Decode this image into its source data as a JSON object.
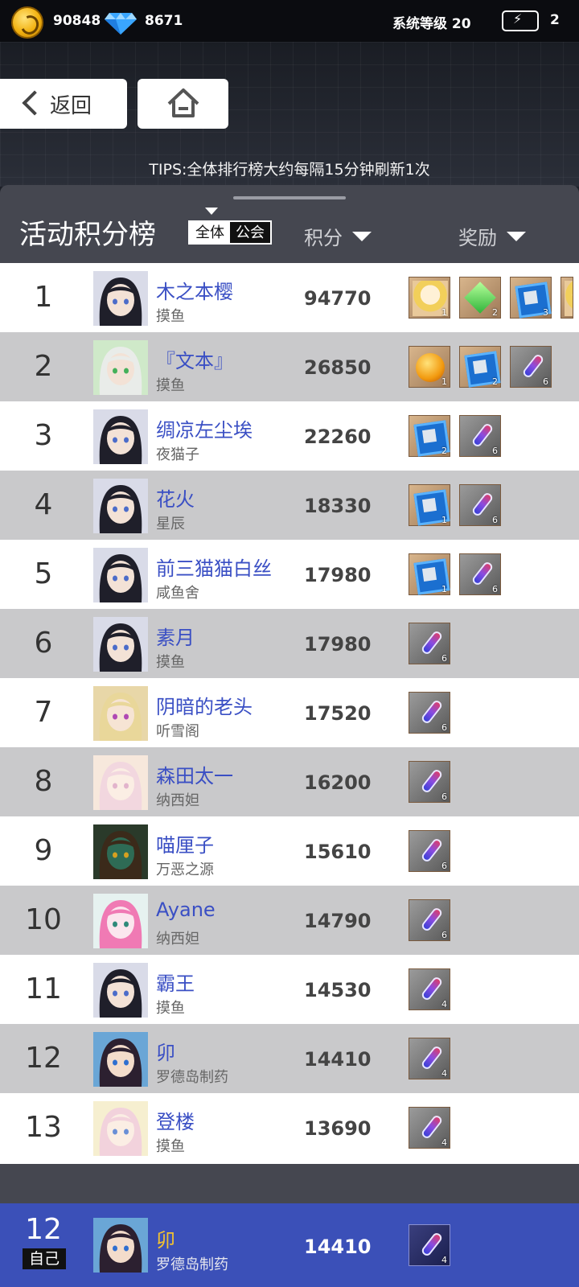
{
  "topbar": {
    "coins": "90848",
    "gems": "8671",
    "system_level": "系统等级 20",
    "energy": "2"
  },
  "nav": {
    "back_label": "返回"
  },
  "tips": "TIPS:全体排行榜大约每隔15分钟刷新1次",
  "board": {
    "title": "活动积分榜",
    "scope_all": "全体",
    "scope_guild": "公会",
    "col_score": "积分",
    "col_reward": "奖励"
  },
  "rows": [
    {
      "rank": "1",
      "name": "木之本樱",
      "guild": "摸鱼",
      "score": "94770",
      "avatar": "dark-hair-girl",
      "rewards": [
        {
          "type": "portrait",
          "count": "1"
        },
        {
          "type": "gem",
          "count": "2"
        },
        {
          "type": "box",
          "count": "3"
        },
        {
          "type": "portrait-clipped",
          "count": ""
        }
      ]
    },
    {
      "rank": "2",
      "name": "『文本』",
      "guild": "摸鱼",
      "score": "26850",
      "avatar": "white-hair-green",
      "rewards": [
        {
          "type": "orb",
          "count": "1"
        },
        {
          "type": "box",
          "count": "2"
        },
        {
          "type": "vial",
          "count": "6"
        }
      ]
    },
    {
      "rank": "3",
      "name": "绸凉左尘埃",
      "guild": "夜猫子",
      "score": "22260",
      "avatar": "dark-hair-girl",
      "rewards": [
        {
          "type": "box",
          "count": "2"
        },
        {
          "type": "vial",
          "count": "6"
        }
      ]
    },
    {
      "rank": "4",
      "name": "花火",
      "guild": "星辰",
      "score": "18330",
      "avatar": "dark-hair-girl",
      "rewards": [
        {
          "type": "box",
          "count": "1"
        },
        {
          "type": "vial",
          "count": "6"
        }
      ]
    },
    {
      "rank": "5",
      "name": "前三猫猫白丝",
      "guild": "咸鱼舍",
      "score": "17980",
      "avatar": "dark-hair-girl",
      "rewards": [
        {
          "type": "box",
          "count": "1"
        },
        {
          "type": "vial",
          "count": "6"
        }
      ]
    },
    {
      "rank": "6",
      "name": "素月",
      "guild": "摸鱼",
      "score": "17980",
      "avatar": "dark-hair-girl",
      "rewards": [
        {
          "type": "vial",
          "count": "6"
        }
      ]
    },
    {
      "rank": "7",
      "name": "阴暗的老头",
      "guild": "听雪阁",
      "score": "17520",
      "avatar": "blonde-bunny",
      "rewards": [
        {
          "type": "vial",
          "count": "6"
        }
      ]
    },
    {
      "rank": "8",
      "name": "森田太一",
      "guild": "纳西妲",
      "score": "16200",
      "avatar": "pink-hair-girl",
      "rewards": [
        {
          "type": "vial",
          "count": "6"
        }
      ]
    },
    {
      "rank": "9",
      "name": "喵厘子",
      "guild": "万恶之源",
      "score": "15610",
      "avatar": "masked-green",
      "rewards": [
        {
          "type": "vial",
          "count": "6"
        }
      ]
    },
    {
      "rank": "10",
      "name": "Ayane",
      "guild": "纳西妲",
      "score": "14790",
      "avatar": "pink-cat-girl",
      "rewards": [
        {
          "type": "vial",
          "count": "6"
        }
      ]
    },
    {
      "rank": "11",
      "name": "霸王",
      "guild": "摸鱼",
      "score": "14530",
      "avatar": "dark-hair-girl",
      "rewards": [
        {
          "type": "vial",
          "count": "4"
        }
      ]
    },
    {
      "rank": "12",
      "name": "卯",
      "guild": "罗德岛制药",
      "score": "14410",
      "avatar": "fan-girl",
      "rewards": [
        {
          "type": "vial",
          "count": "4"
        }
      ]
    },
    {
      "rank": "13",
      "name": "登楼",
      "guild": "摸鱼",
      "score": "13690",
      "avatar": "pink-hair-wink",
      "rewards": [
        {
          "type": "vial",
          "count": "4"
        }
      ]
    }
  ],
  "self_row": {
    "rank": "12",
    "tag": "自己",
    "name": "卯",
    "guild": "罗德岛制药",
    "score": "14410",
    "avatar": "fan-girl",
    "rewards": [
      {
        "type": "vial",
        "count": "4"
      }
    ]
  },
  "colors": {
    "accent_blue": "#3b50b8",
    "name_blue": "#3a4fc4",
    "self_name": "#f2c230",
    "panel": "#454750"
  }
}
